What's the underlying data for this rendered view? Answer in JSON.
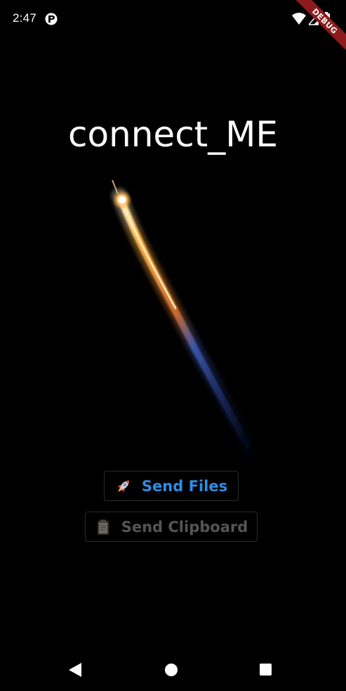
{
  "status_bar": {
    "time": "2:47",
    "icons": [
      "app-notification-icon",
      "wifi-icon",
      "signal-icon",
      "battery-icon"
    ]
  },
  "debug_banner": {
    "label": "DEBUG",
    "color": "#8e1b1b"
  },
  "main": {
    "title": "connect_ME",
    "image": "rocket-launch-image",
    "buttons": [
      {
        "label": "Send Files",
        "icon": "rocket-icon",
        "color": "#2f8de4",
        "enabled": true
      },
      {
        "label": "Send Clipboard",
        "icon": "clipboard-icon",
        "color": "#555555",
        "enabled": false
      }
    ]
  },
  "nav_bar": {
    "icons": [
      "back-icon",
      "home-icon",
      "recents-icon"
    ]
  },
  "colors": {
    "background": "#000000",
    "accent": "#2f8de4",
    "text": "#ffffff"
  }
}
